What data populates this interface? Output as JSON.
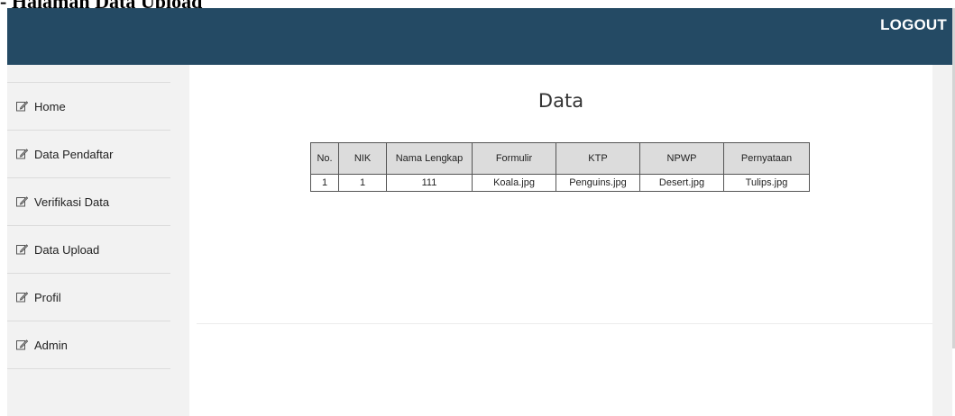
{
  "doc_heading": "Halaman Data Upload",
  "header": {
    "logout_label": "LOGOUT"
  },
  "sidebar": {
    "items": [
      {
        "label": "Home"
      },
      {
        "label": "Data Pendaftar"
      },
      {
        "label": "Verifikasi Data"
      },
      {
        "label": "Data Upload"
      },
      {
        "label": "Profil"
      },
      {
        "label": "Admin"
      }
    ]
  },
  "main": {
    "title": "Data",
    "table": {
      "headers": [
        "No.",
        "NIK",
        "Nama Lengkap",
        "Formulir",
        "KTP",
        "NPWP",
        "Pernyataan"
      ],
      "rows": [
        [
          "1",
          "1",
          "111",
          "Koala.jpg",
          "Penguins.jpg",
          "Desert.jpg",
          "Tulips.jpg"
        ]
      ]
    }
  },
  "colors": {
    "topbar": "#244a64",
    "page_bg": "#f2f2f2",
    "table_header_bg": "#dcdcdc"
  },
  "icons": {
    "nav": "edit-icon"
  }
}
